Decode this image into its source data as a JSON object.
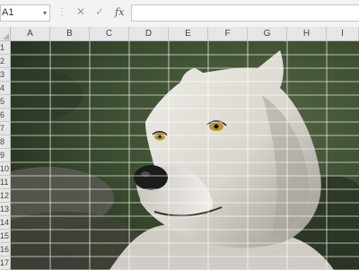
{
  "formula_bar": {
    "name_box": "A1",
    "name_box_arrow": "▾",
    "separator": "⋮",
    "cancel_symbol": "✕",
    "enter_symbol": "✓",
    "fx_symbol": "fx",
    "formula_value": ""
  },
  "columns": [
    "A",
    "B",
    "C",
    "D",
    "E",
    "F",
    "G",
    "H",
    "I"
  ],
  "rows": [
    "1",
    "2",
    "3",
    "4",
    "5",
    "6",
    "7",
    "8",
    "9",
    "10",
    "11",
    "12",
    "13",
    "14",
    "15",
    "16",
    "17"
  ],
  "sheet_image": {
    "subject": "white wolf portrait photo",
    "colors": {
      "background_dark": "#2c3a24",
      "background_mid": "#4a5a3a",
      "fur_light": "#e9e7e1",
      "fur_shadow": "#8f8c86",
      "eye": "#b8962a",
      "nose": "#1c1c1c",
      "grid": "#ffffff"
    }
  }
}
